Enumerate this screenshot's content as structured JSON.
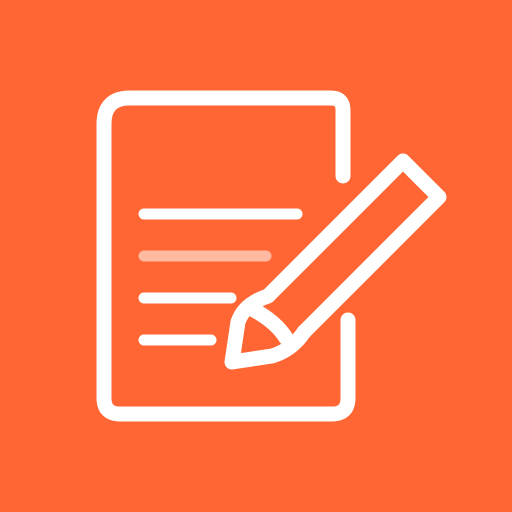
{
  "icon": {
    "name": "notes-edit-app-icon",
    "background_color": "#FF6633",
    "foreground_color": "#FFFFFF",
    "highlight_line_color": "#FFB9A0",
    "glyphs": [
      "document-icon",
      "text-lines",
      "pencil-icon"
    ]
  }
}
